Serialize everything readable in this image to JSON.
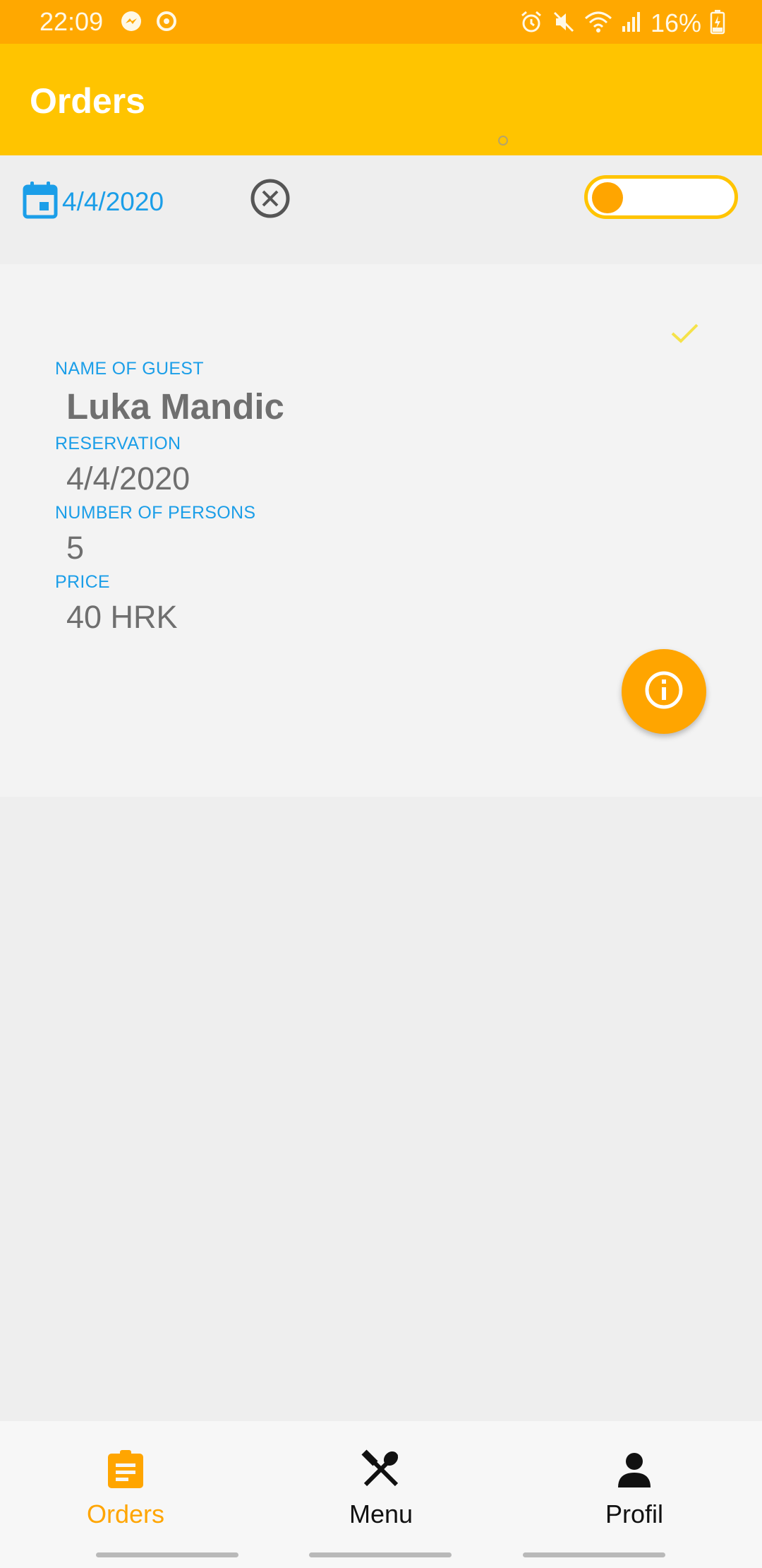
{
  "status_bar": {
    "time": "22:09",
    "battery_percent": "16%",
    "left_icons": [
      "messenger-icon",
      "sync-icon"
    ],
    "right_icons": [
      "alarm-icon",
      "mute-icon",
      "wifi-icon",
      "signal-icon",
      "battery-icon"
    ]
  },
  "app_bar": {
    "title": "Orders"
  },
  "filter": {
    "date": "4/4/2020",
    "toggle_on": false
  },
  "order": {
    "guest_label": "NAME OF GUEST",
    "guest_name": "Luka Mandic",
    "reservation_label": "RESERVATION",
    "reservation_date": "4/4/2020",
    "persons_label": "NUMBER OF PERSONS",
    "persons": "5",
    "price_label": "PRICE",
    "price": "40 HRK"
  },
  "bottom_nav": {
    "items": [
      {
        "label": "Orders",
        "icon": "clipboard-icon",
        "active": true
      },
      {
        "label": "Menu",
        "icon": "utensils-icon",
        "active": false
      },
      {
        "label": "Profil",
        "icon": "person-icon",
        "active": false
      }
    ]
  },
  "colors": {
    "status_bar": "#ffa800",
    "app_bar": "#ffc400",
    "accent": "#ffa500",
    "label_blue": "#1b9ee8"
  }
}
